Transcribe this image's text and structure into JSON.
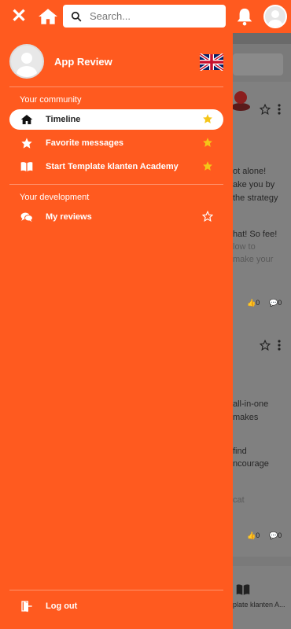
{
  "header": {
    "search_placeholder": "Search...",
    "close_icon": "close-icon",
    "home_icon": "home-icon",
    "bell_icon": "bell-icon"
  },
  "drawer": {
    "profile": {
      "name": "App Review",
      "language_flag": "uk-flag-icon"
    },
    "sections": [
      {
        "title": "Your community",
        "items": [
          {
            "label": "Timeline",
            "icon": "home-icon",
            "starred": true,
            "active": true
          },
          {
            "label": "Favorite messages",
            "icon": "star-icon",
            "starred": true,
            "active": false
          },
          {
            "label": "Start Template klanten Academy",
            "icon": "book-icon",
            "starred": true,
            "active": false
          }
        ]
      },
      {
        "title": "Your development",
        "items": [
          {
            "label": "My reviews",
            "icon": "comments-icon",
            "starred": false,
            "active": false
          }
        ]
      }
    ],
    "logout_label": "Log out"
  },
  "background": {
    "post1_lines": [
      "ot alone!",
      "ake you by",
      "the strategy",
      "hat! So fee!",
      "low to",
      "make your"
    ],
    "post1_likes": "0",
    "post1_comments": "0",
    "post2_lines": [
      "all-in-one",
      "makes",
      "find",
      "ncourage",
      "cat"
    ],
    "post2_likes": "0",
    "post2_comments": "0",
    "post3_line": "plate klanten A..."
  },
  "colors": {
    "brand": "#ff5a1f",
    "star_active": "#f5c518"
  }
}
